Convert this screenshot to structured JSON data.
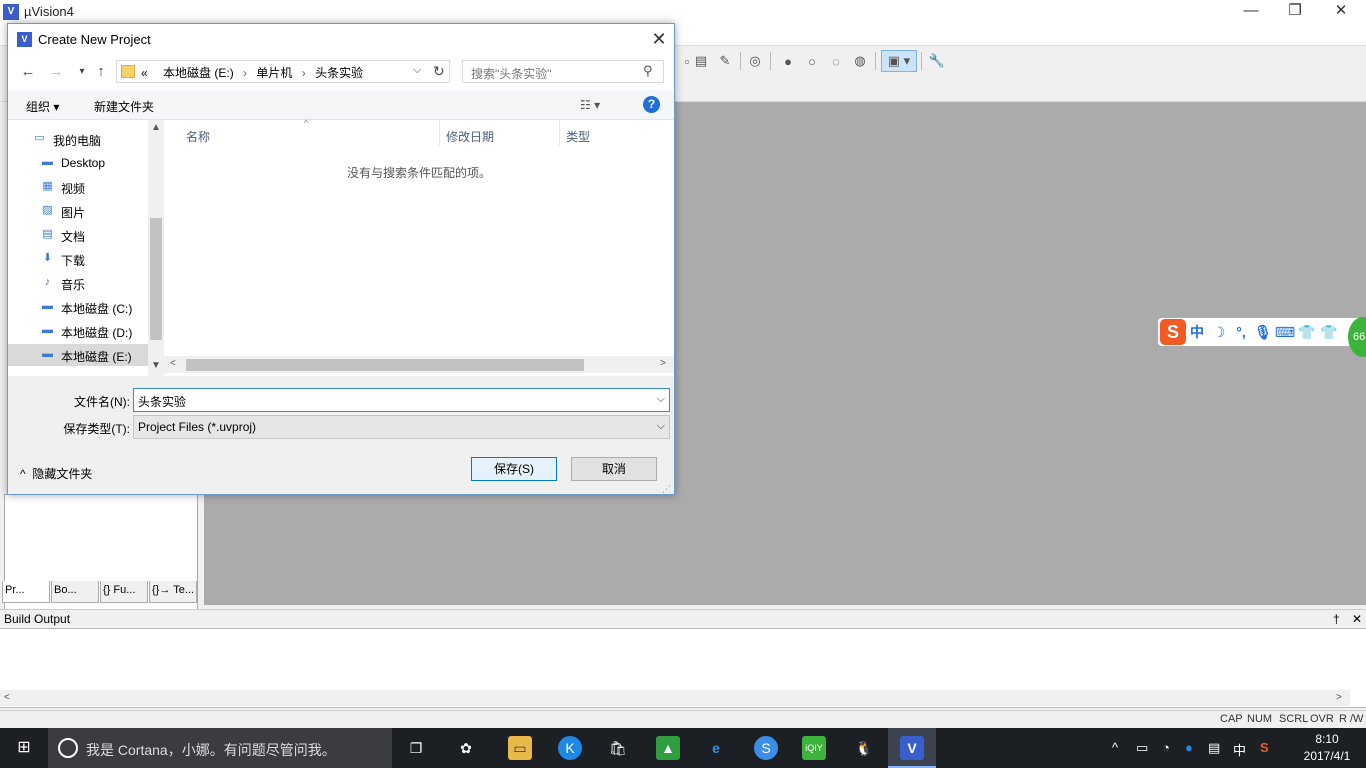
{
  "app": {
    "title": "µVision4",
    "icon_text": "V"
  },
  "window_controls": {
    "minimize": "—",
    "restore": "❐",
    "close": "✕"
  },
  "left_tabs": [
    "Pr...",
    "Bo...",
    "{} Fu...",
    "{}→ Te..."
  ],
  "build_output": {
    "title": "Build Output",
    "pin": "†",
    "close": "✕"
  },
  "status": {
    "cap": "CAP",
    "num": "NUM",
    "scrl": "SCRL",
    "ovr": "OVR",
    "rw": "R /W"
  },
  "ime": {
    "logo": "S",
    "items": [
      "中",
      "☽",
      "°,",
      "🎙",
      "⌨",
      "👕",
      "👕"
    ],
    "badge": "66"
  },
  "dialog": {
    "title": "Create New Project",
    "icon_text": "V",
    "address": {
      "prefix": "«",
      "crumbs": [
        "本地磁盘 (E:)",
        "单片机",
        "头条实验"
      ]
    },
    "search_placeholder": "搜索\"头条实验\"",
    "toolbar": {
      "organize": "组织 ▾",
      "new_folder": "新建文件夹",
      "view": "☷ ▾"
    },
    "nav_items": [
      {
        "label": "我的电脑",
        "icon": "computer-icon",
        "glyph": "▭"
      },
      {
        "label": "Desktop",
        "icon": "desktop-icon",
        "glyph": "▬"
      },
      {
        "label": "视频",
        "icon": "video-icon",
        "glyph": "▦"
      },
      {
        "label": "图片",
        "icon": "pictures-icon",
        "glyph": "▨"
      },
      {
        "label": "文档",
        "icon": "documents-icon",
        "glyph": "▤"
      },
      {
        "label": "下载",
        "icon": "downloads-icon",
        "glyph": "⬇"
      },
      {
        "label": "音乐",
        "icon": "music-icon",
        "glyph": "♪"
      },
      {
        "label": "本地磁盘 (C:)",
        "icon": "drive-c-icon",
        "glyph": "▬"
      },
      {
        "label": "本地磁盘 (D:)",
        "icon": "drive-d-icon",
        "glyph": "▬"
      },
      {
        "label": "本地磁盘 (E:)",
        "icon": "drive-e-icon",
        "glyph": "▬"
      }
    ],
    "selected_nav_index": 9,
    "columns": [
      "名称",
      "修改日期",
      "类型"
    ],
    "empty_message": "没有与搜索条件匹配的项。",
    "filename_label": "文件名(N):",
    "filename_value": "头条实验",
    "filetype_label": "保存类型(T):",
    "filetype_value": "Project Files (*.uvproj)",
    "hide_folders": "隐藏文件夹",
    "save_button": "保存(S)",
    "cancel_button": "取消"
  },
  "taskbar": {
    "cortana_text": "我是 Cortana，小娜。有问题尽管问我。",
    "tray_lang": "中",
    "time": "8:10",
    "date": "2017/4/1"
  },
  "colors": {
    "accent": "#0078d7",
    "editor_bg": "#ababab",
    "taskbar_bg": "#1c1f24"
  }
}
